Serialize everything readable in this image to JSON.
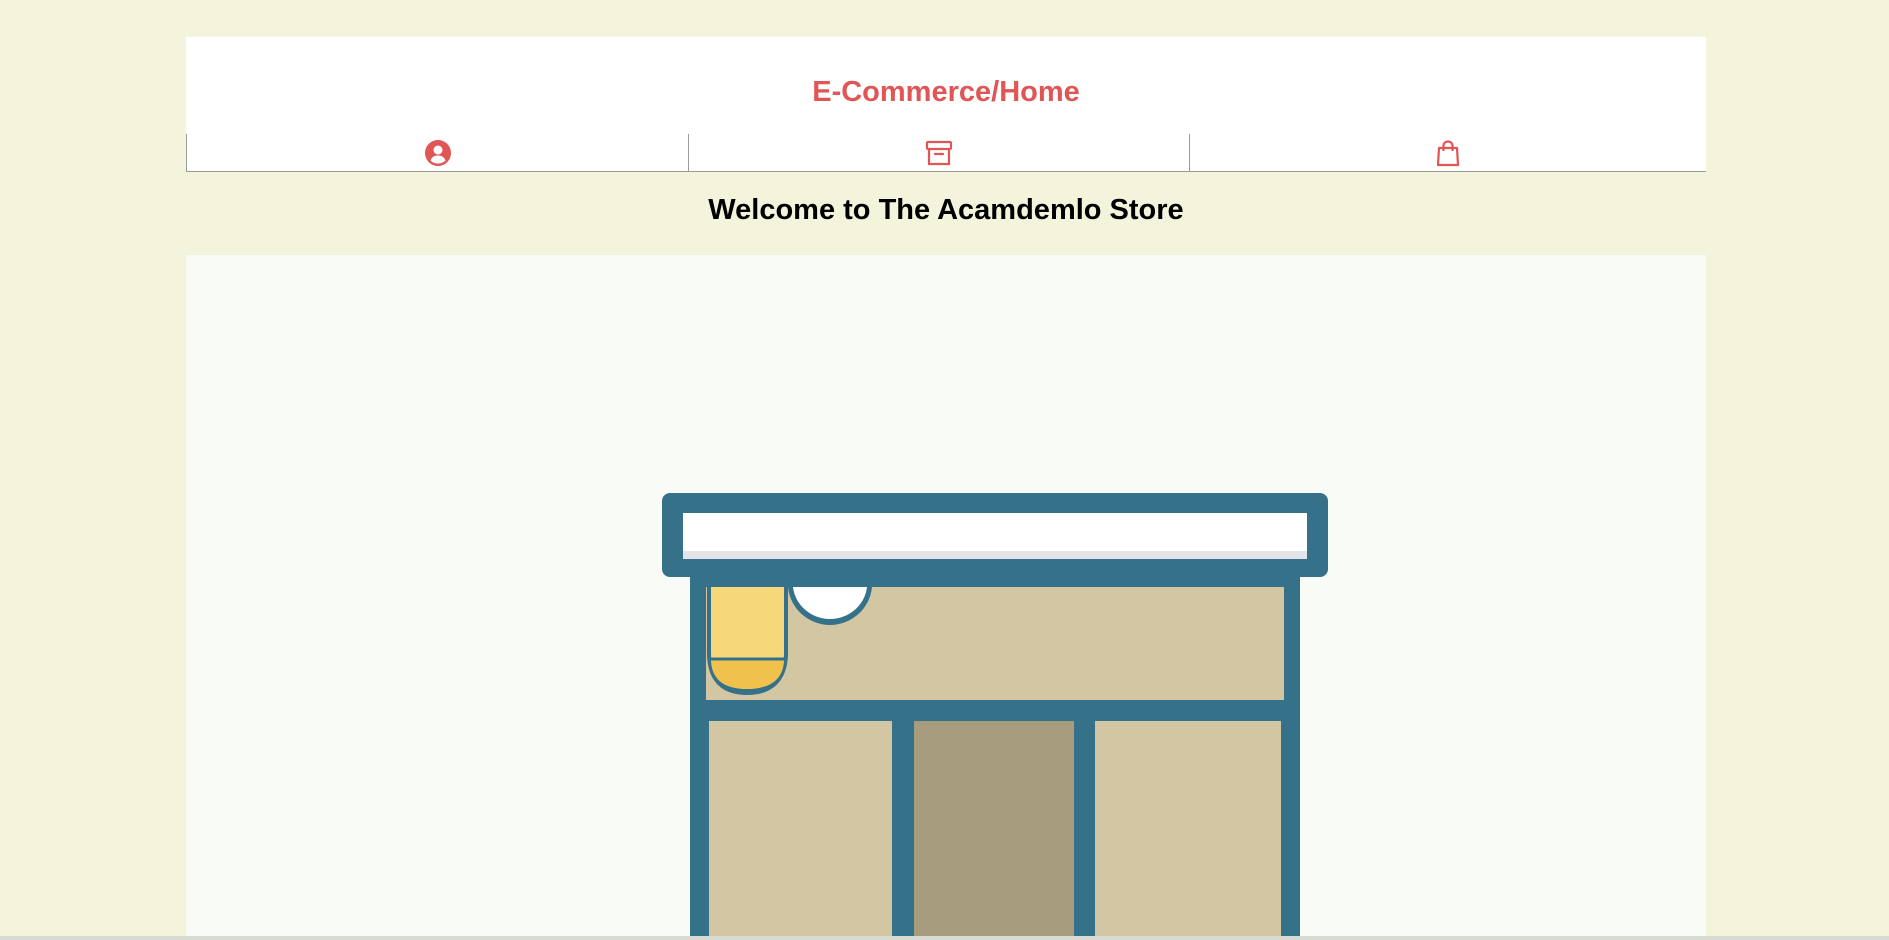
{
  "header": {
    "brand": "E-Commerce/Home",
    "accent_color": "#e05555",
    "tabs": [
      {
        "icon": "user-circle-icon"
      },
      {
        "icon": "archive-box-icon"
      },
      {
        "icon": "shopping-bag-icon"
      }
    ]
  },
  "main": {
    "welcome": "Welcome to The Acamdemlo Store",
    "hero_image": "store-front-illustration"
  }
}
